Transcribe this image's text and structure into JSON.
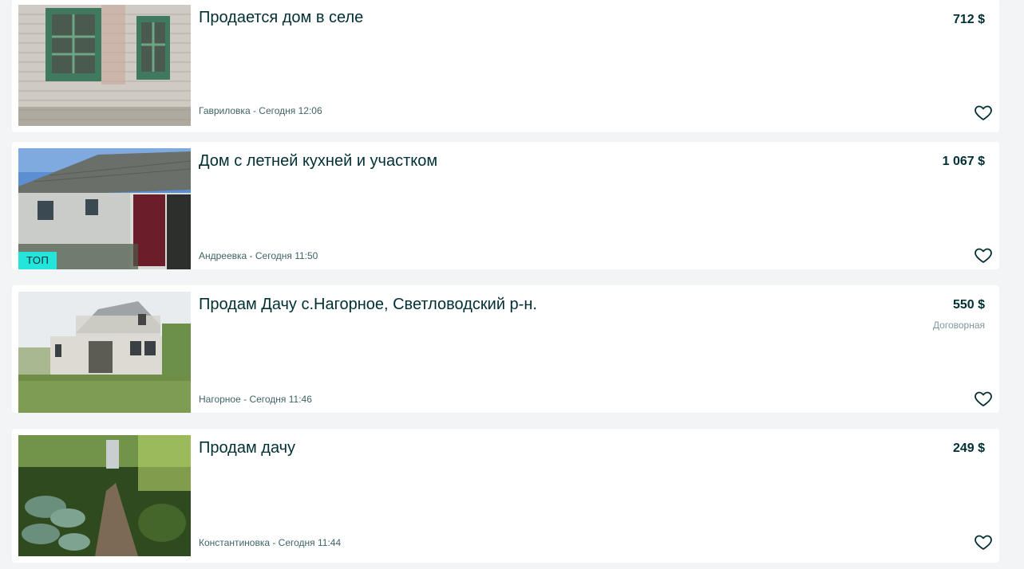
{
  "listings": [
    {
      "title": "Продается дом в селе",
      "meta": "Гавриловка - Сегодня 12:06",
      "price": "712 $",
      "image_icon": "brick-house-photo",
      "favorite_icon": "heart-outline-icon"
    },
    {
      "title": "Дом с летней кухней и участком",
      "meta": "Андреевка - Сегодня 11:50",
      "price": "1 067 $",
      "badge": "ТОП",
      "badge_color": "#23e5db",
      "image_icon": "white-house-photo",
      "favorite_icon": "heart-outline-icon"
    },
    {
      "title": "Продам Дачу с.Нагорное, Светловодский р-н.",
      "meta": "Нагорное - Сегодня 11:46",
      "price": "550 $",
      "price_note": "Договорная",
      "image_icon": "dacha-house-photo",
      "favorite_icon": "heart-outline-icon"
    },
    {
      "title": "Продам дачу",
      "meta": "Константиновка - Сегодня 11:44",
      "price": "249 $",
      "image_icon": "garden-photo",
      "favorite_icon": "heart-outline-icon"
    }
  ],
  "colors": {
    "background": "#f2f4f5",
    "card": "#ffffff",
    "text": "#002f34",
    "meta_text": "#406367",
    "muted_text": "#7f9799",
    "top_badge": "#23e5db"
  }
}
